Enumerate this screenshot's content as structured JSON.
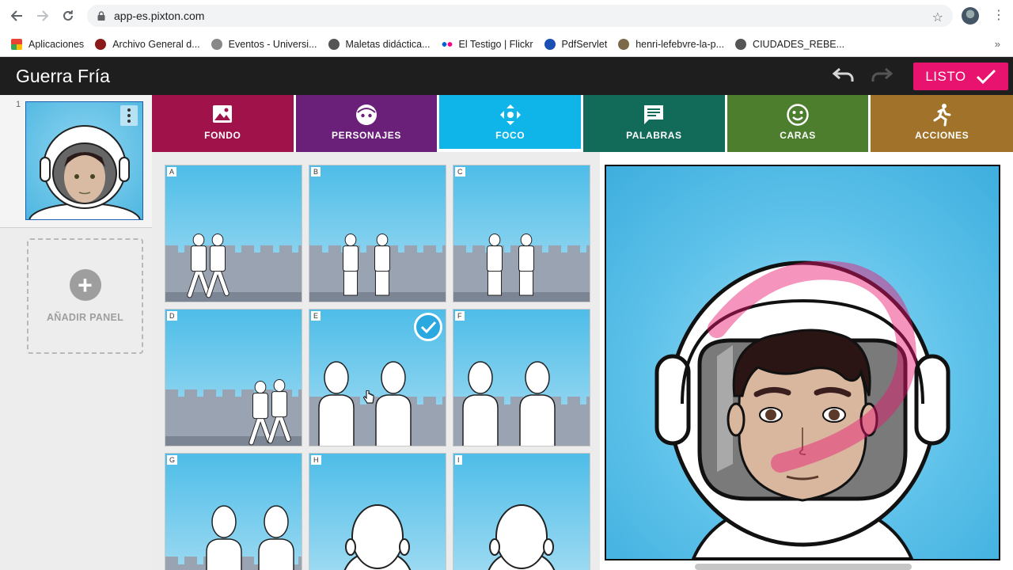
{
  "browser": {
    "url": "app-es.pixton.com",
    "bookmarks": [
      {
        "label": "Aplicaciones",
        "icon": "apps-grid-icon"
      },
      {
        "label": "Archivo General d...",
        "icon": "archivo-icon"
      },
      {
        "label": "Eventos - Universi...",
        "icon": "universidad-icon"
      },
      {
        "label": "Maletas didáctica...",
        "icon": "maletas-icon"
      },
      {
        "label": "El Testigo | Flickr",
        "icon": "flickr-icon"
      },
      {
        "label": "PdfServlet",
        "icon": "pdf-icon"
      },
      {
        "label": "henri-lefebvre-la-p...",
        "icon": "book-icon"
      },
      {
        "label": "CIUDADES_REBE...",
        "icon": "globe-icon"
      }
    ],
    "more": "»"
  },
  "app": {
    "title": "Guerra Fría",
    "done_label": "LISTO"
  },
  "sidebar": {
    "panel_number": "1",
    "add_panel_label": "AÑADIR PANEL"
  },
  "tabs": [
    {
      "label": "FONDO",
      "color": "#a0134a",
      "icon": "image-icon"
    },
    {
      "label": "PERSONAJES",
      "color": "#6a1f78",
      "icon": "character-face-icon"
    },
    {
      "label": "FOCO",
      "color": "#0fb5e8",
      "icon": "focus-move-icon",
      "active": true
    },
    {
      "label": "PALABRAS",
      "color": "#126b58",
      "icon": "speech-bubble-icon"
    },
    {
      "label": "CARAS",
      "color": "#4d7e2e",
      "icon": "smiley-icon"
    },
    {
      "label": "ACCIONES",
      "color": "#a0722a",
      "icon": "running-figure-icon"
    }
  ],
  "focus_options": [
    {
      "letter": "A",
      "view": "wide-walking"
    },
    {
      "letter": "B",
      "view": "wide-standing"
    },
    {
      "letter": "C",
      "view": "wide-standing"
    },
    {
      "letter": "D",
      "view": "wide-walking-right"
    },
    {
      "letter": "E",
      "view": "medium",
      "selected": true
    },
    {
      "letter": "F",
      "view": "medium"
    },
    {
      "letter": "G",
      "view": "medium-close"
    },
    {
      "letter": "H",
      "view": "close-up"
    },
    {
      "letter": "I",
      "view": "close-up"
    }
  ]
}
